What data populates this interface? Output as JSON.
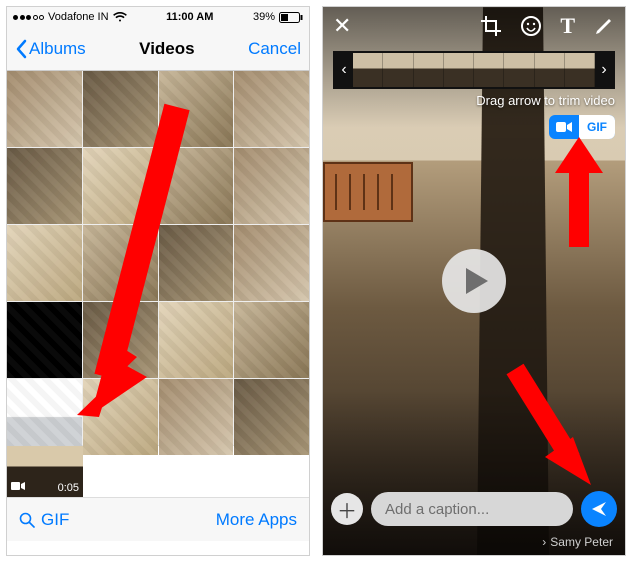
{
  "left": {
    "status": {
      "carrier": "Vodafone IN",
      "time": "11:00 AM",
      "battery": "39%"
    },
    "nav": {
      "back": "Albums",
      "title": "Videos",
      "cancel": "Cancel"
    },
    "thumb": {
      "duration": "0:05"
    },
    "footer": {
      "gif": "GIF",
      "more": "More Apps"
    }
  },
  "right": {
    "hint": "Drag arrow to trim video",
    "gif_toggle": "GIF",
    "caption_placeholder": "Add a caption...",
    "recipient": "Samy Peter"
  }
}
